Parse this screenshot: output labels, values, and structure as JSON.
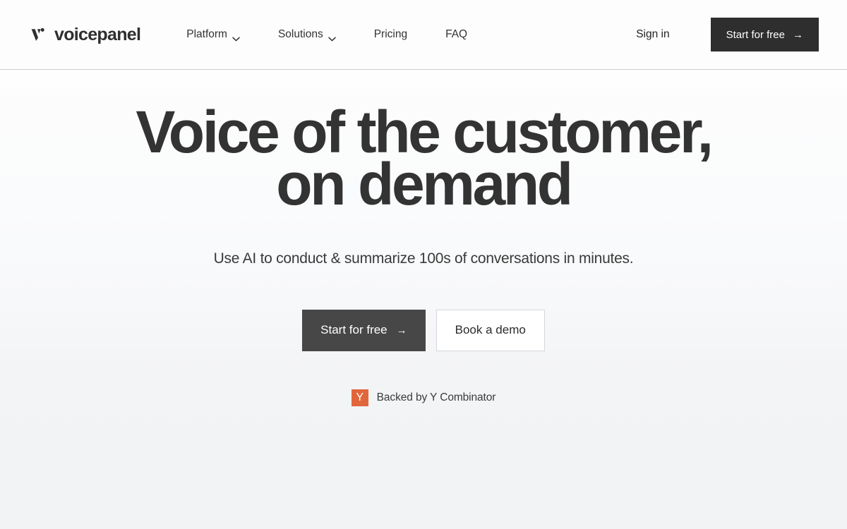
{
  "brand": {
    "name": "voicepanel",
    "logo_icon": "voicepanel-v-mark-icon"
  },
  "nav": {
    "items": [
      {
        "label": "Platform",
        "has_dropdown": true,
        "icon": "chevron-down-icon"
      },
      {
        "label": "Solutions",
        "has_dropdown": true,
        "icon": "chevron-down-icon"
      },
      {
        "label": "Pricing",
        "has_dropdown": false,
        "icon": ""
      },
      {
        "label": "FAQ",
        "has_dropdown": false,
        "icon": ""
      }
    ]
  },
  "header_actions": {
    "signin_label": "Sign in",
    "cta_label": "Start for free",
    "cta_icon": "arrow-right-icon",
    "cta_arrow": "→"
  },
  "hero": {
    "headline_line_1": "Voice of the customer,",
    "headline_line_2": "on demand",
    "subheadline": "Use AI to conduct & summarize 100s of conversations in minutes.",
    "primary_cta_label": "Start for free",
    "primary_cta_arrow": "→",
    "primary_cta_icon": "arrow-right-icon",
    "secondary_cta_label": "Book a demo"
  },
  "badge": {
    "mark_letter": "Y",
    "mark_icon": "y-combinator-logo-icon",
    "text": "Backed by Y Combinator"
  },
  "colors": {
    "header_cta_bg": "#2e2e2e",
    "hero_cta_bg": "#474747",
    "text_primary": "#333333",
    "yc_orange": "#e2663b",
    "outline_border": "#d5d7db",
    "header_border": "#c9ccd0",
    "hero_bg_bottom": "#f2f3f5"
  }
}
